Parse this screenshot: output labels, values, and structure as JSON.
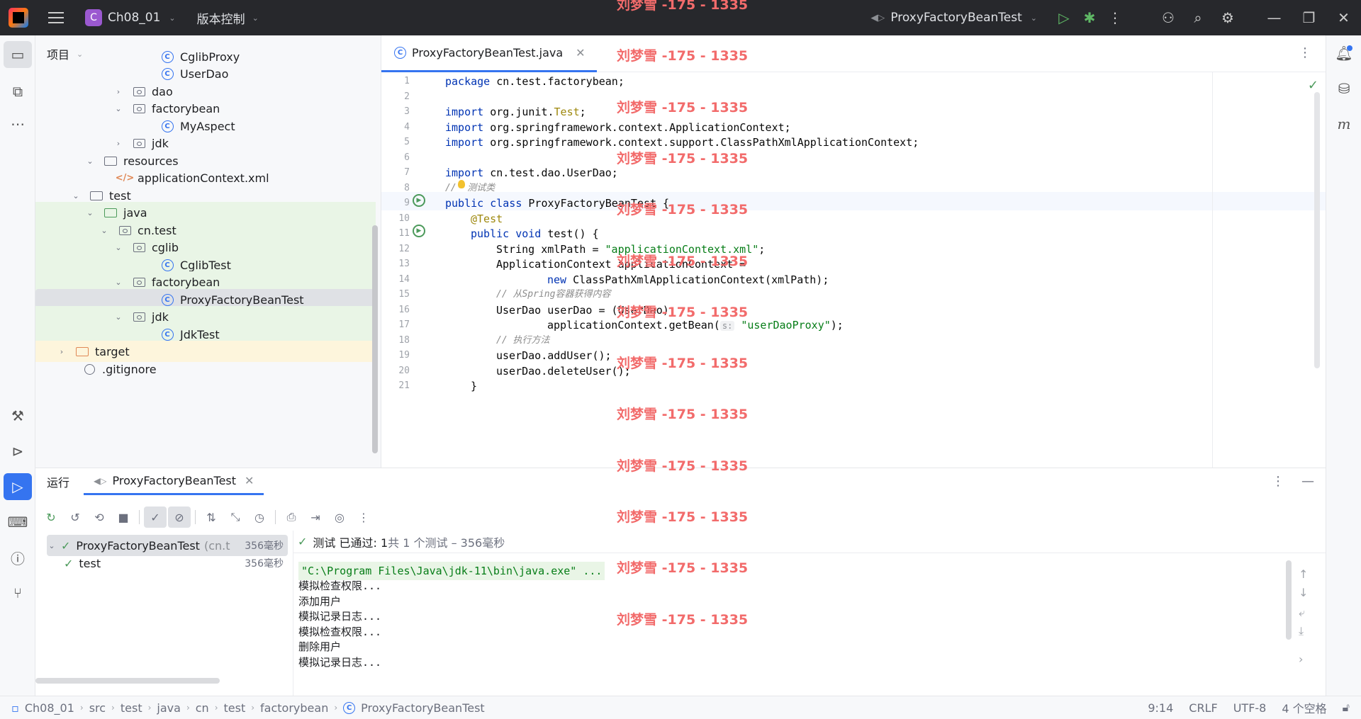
{
  "titlebar": {
    "project_badge": "C",
    "project_name": "Ch08_01",
    "vcs_label": "版本控制",
    "run_config": "ProxyFactoryBeanTest"
  },
  "watermark": "刘梦雪 -175 - 1335",
  "project_panel": {
    "title": "项目",
    "rows": [
      {
        "label": "CglibProxy",
        "type": "class"
      },
      {
        "label": "UserDao",
        "type": "class"
      },
      {
        "label": "dao",
        "type": "package",
        "arrow": "collapsed"
      },
      {
        "label": "factorybean",
        "type": "package",
        "arrow": "expanded"
      },
      {
        "label": "MyAspect",
        "type": "class"
      },
      {
        "label": "jdk",
        "type": "package",
        "arrow": "collapsed"
      },
      {
        "label": "resources",
        "type": "folder",
        "arrow": "expanded"
      },
      {
        "label": "applicationContext.xml",
        "type": "xml"
      },
      {
        "label": "test",
        "type": "folder",
        "arrow": "expanded"
      },
      {
        "label": "java",
        "type": "folder-green",
        "arrow": "expanded"
      },
      {
        "label": "cn.test",
        "type": "package",
        "arrow": "expanded"
      },
      {
        "label": "cglib",
        "type": "package",
        "arrow": "expanded"
      },
      {
        "label": "CglibTest",
        "type": "class"
      },
      {
        "label": "factorybean",
        "type": "package",
        "arrow": "expanded"
      },
      {
        "label": "ProxyFactoryBeanTest",
        "type": "class"
      },
      {
        "label": "jdk",
        "type": "package",
        "arrow": "expanded"
      },
      {
        "label": "JdkTest",
        "type": "class"
      },
      {
        "label": "target",
        "type": "folder-orange",
        "arrow": "collapsed"
      },
      {
        "label": ".gitignore",
        "type": "git"
      }
    ]
  },
  "editor": {
    "tab_label": "ProxyFactoryBeanTest.java",
    "line_numbers": [
      "1",
      "2",
      "3",
      "4",
      "5",
      "6",
      "7",
      "8",
      "9",
      "10",
      "11",
      "12",
      "13",
      "14",
      "15",
      "16",
      "17",
      "18",
      "19",
      "20",
      "21"
    ],
    "code": {
      "l1_kw": "package",
      "l1_rest": " cn.test.factorybean;",
      "l3_kw": "import",
      "l3_mid": " org.junit.",
      "l3_cls": "Test",
      "l3_end": ";",
      "l4_kw": "import",
      "l4_rest": " org.springframework.context.ApplicationContext;",
      "l5_kw": "import",
      "l5_rest": " org.springframework.context.support.ClassPathXmlApplicationContext;",
      "l7_kw": "import",
      "l7_rest": " cn.test.dao.UserDao;",
      "l8_cmt": "//  测试类",
      "l9_kw1": "public",
      "l9_kw2": "class",
      "l9_rest": " ProxyFactoryBeanTest {",
      "l10_ann": "@Test",
      "l11_kw1": "public",
      "l11_kw2": "void",
      "l11_rest": " test() {",
      "l12_a": "String xmlPath = ",
      "l12_str": "\"applicationContext.xml\"",
      "l12_b": ";",
      "l13": "ApplicationContext applicationContext =",
      "l14_kw": "new",
      "l14_rest": " ClassPathXmlApplicationContext(xmlPath);",
      "l15_cmt": "// 从Spring容器获得内容",
      "l16": "UserDao userDao = (UserDao)",
      "l17_a": "applicationContext.getBean(",
      "l17_hint": "s:",
      "l17_str": "\"userDaoProxy\"",
      "l17_b": ");",
      "l18_cmt": "// 执行方法",
      "l19": "userDao.addUser();",
      "l20": "userDao.deleteUser();",
      "l21": "}"
    }
  },
  "run_panel": {
    "title": "运行",
    "tab_label": "ProxyFactoryBeanTest",
    "tree": {
      "root_label": "ProxyFactoryBeanTest",
      "root_pkg": "(cn.t",
      "root_time": "356毫秒",
      "child_label": "test",
      "child_time": "356毫秒"
    },
    "status_main": "测试 已通过: 1",
    "status_sub": "共 1 个测试 – 356毫秒",
    "console": [
      "\"C:\\Program Files\\Java\\jdk-11\\bin\\java.exe\" ...",
      "模拟检查权限...",
      "添加用户",
      "模拟记录日志...",
      "模拟检查权限...",
      "删除用户",
      "模拟记录日志..."
    ]
  },
  "statusbar": {
    "breadcrumbs": [
      "Ch08_01",
      "src",
      "test",
      "java",
      "cn",
      "test",
      "factorybean",
      "ProxyFactoryBeanTest"
    ],
    "position": "9:14",
    "line_sep": "CRLF",
    "encoding": "UTF-8",
    "indent": "4 个空格"
  },
  "colors": {
    "accent": "#3574f0",
    "success": "#4c9a5b",
    "watermark": "#f26b6b"
  }
}
